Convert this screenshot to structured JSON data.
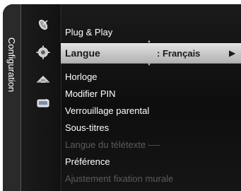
{
  "sidebar": {
    "label": "Configuration",
    "icons": [
      "satellite-icon",
      "gear-icon",
      "input-icon",
      "application-icon"
    ]
  },
  "menu": {
    "items": [
      {
        "label": "Plug & Play",
        "enabled": true
      },
      {
        "label": "Langue",
        "value": ": Français",
        "selected": true,
        "enabled": true
      },
      {
        "label": "Horloge",
        "enabled": true
      },
      {
        "label": "Modifier PIN",
        "enabled": true
      },
      {
        "label": "Verrouillage parental",
        "enabled": true
      },
      {
        "label": "Sous-titres",
        "enabled": true
      },
      {
        "label": "Langue du télétexte",
        "value": ": ----",
        "enabled": false
      },
      {
        "label": "Préférence",
        "enabled": true
      },
      {
        "label": "Ajustement fixation murale",
        "enabled": false
      }
    ],
    "selected_arrow": "▶"
  },
  "colors": {
    "background": "#0e0e0e",
    "highlight": "#c8c8c8",
    "disabled_text": "#5c5c5c"
  }
}
